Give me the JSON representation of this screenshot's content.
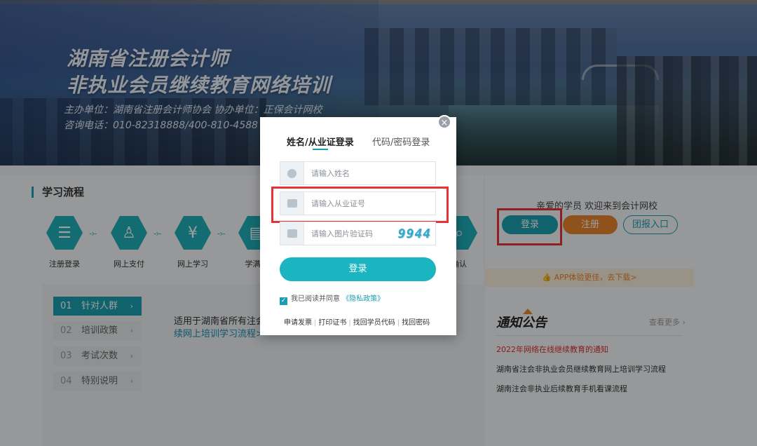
{
  "banner": {
    "title_line1": "湖南省注册会计师",
    "title_line2": "非执业会员继续教育网络培训",
    "org_line": "主办单位：湖南省注册会计师协会   协办单位：正保会计网校",
    "tel_line": "咨询电话：010-82318888/400-810-4588"
  },
  "process": {
    "title": "学习流程",
    "steps": [
      {
        "label": "注册登录",
        "icon": "clipboard-icon"
      },
      {
        "label": "网上支付",
        "icon": "user-check-icon"
      },
      {
        "label": "网上学习",
        "icon": "money-bag-icon"
      },
      {
        "label": "学满学",
        "icon": "certificate-icon"
      },
      {
        "label": "确认",
        "icon": "search-icon"
      }
    ]
  },
  "submenu": {
    "items": [
      {
        "num": "01",
        "label": "针对人群",
        "chev": "›"
      },
      {
        "num": "02",
        "label": "培训政策",
        "chev": "›"
      },
      {
        "num": "03",
        "label": "考试次数",
        "chev": "›"
      },
      {
        "num": "04",
        "label": "特别说明",
        "chev": "›"
      }
    ],
    "desc_line1": "适用于湖南省所有注会",
    "desc_line2": "续网上培训学习流程>"
  },
  "sidebar": {
    "welcome": "亲爱的学员 欢迎来到会计网校",
    "login_button": "登录",
    "register_button": "注册",
    "group_button": "团报入口",
    "app_bar": "APP体验更佳，去下载>",
    "notice_title": "通知公告",
    "more_link": "查看更多 ›",
    "notices": [
      "2022年网络在线继续教育的通知",
      "湖南省注会非执业会员继续教育网上培训学习流程",
      "湖南注会非执业后续教育手机看课流程"
    ]
  },
  "modal": {
    "close": "×",
    "tab_name_login": "姓名/从业证登录",
    "tab_code_login": "代码/密码登录",
    "name_placeholder": "请输入姓名",
    "cert_placeholder": "请输入从业证号",
    "captcha_placeholder": "请输入图片验证码",
    "captcha_text": "9944",
    "submit": "登录",
    "agree_text": "我已阅读并同意",
    "privacy_link": "《隐私政策》",
    "links": [
      "申请发票",
      "打印证书",
      "找回学员代码",
      "找回密码"
    ]
  },
  "colors": {
    "accent": "#1a9fb1",
    "orange": "#e8852e",
    "highlight_red": "#e53338"
  }
}
